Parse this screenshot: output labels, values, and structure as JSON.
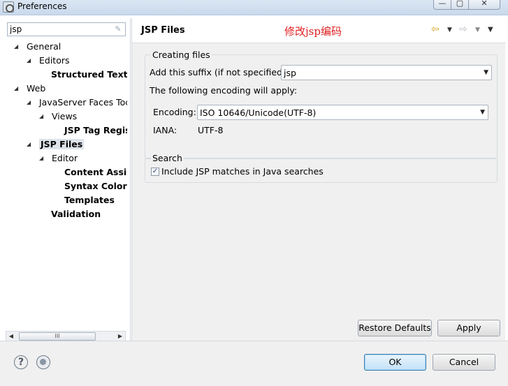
{
  "window": {
    "title": "Preferences",
    "min_glyph": "—",
    "max_glyph": "▢",
    "close_glyph": "✕"
  },
  "sidebar": {
    "filter": {
      "value": "jsp",
      "placeholder": ""
    },
    "tree": [
      {
        "label": "General",
        "expanded": true,
        "bold": false
      },
      {
        "label": "Editors",
        "expanded": true,
        "bold": false
      },
      {
        "label": "Structured Text E",
        "expanded": null,
        "bold": true
      },
      {
        "label": "Web",
        "expanded": true,
        "bold": false
      },
      {
        "label": "JavaServer Faces Toc",
        "expanded": true,
        "bold": false
      },
      {
        "label": "Views",
        "expanded": true,
        "bold": false
      },
      {
        "label": "JSP Tag Regis",
        "expanded": null,
        "bold": true
      },
      {
        "label": "JSP Files",
        "expanded": true,
        "bold": true,
        "selected": true
      },
      {
        "label": "Editor",
        "expanded": true,
        "bold": false
      },
      {
        "label": "Content Assis",
        "expanded": null,
        "bold": true
      },
      {
        "label": "Syntax Colori",
        "expanded": null,
        "bold": true
      },
      {
        "label": "Templates",
        "expanded": null,
        "bold": true
      },
      {
        "label": "Validation",
        "expanded": null,
        "bold": true
      }
    ]
  },
  "page": {
    "title": "JSP Files",
    "annotation": "修改jsp编码",
    "creating_files": {
      "legend": "Creating files",
      "suffix_label": "Add this suffix (if not specified):",
      "suffix_value": "jsp",
      "encoding_note": "The following encoding will apply:",
      "encoding_label": "Encoding:",
      "encoding_value": "ISO 10646/Unicode(UTF-8)",
      "iana_label": "IANA:",
      "iana_value": "UTF-8"
    },
    "search": {
      "legend": "Search",
      "checkbox_label": "Include JSP matches in Java searches",
      "checked": true
    },
    "restore_defaults_label": "Restore Defaults",
    "apply_label": "Apply"
  },
  "footer": {
    "ok_label": "OK",
    "cancel_label": "Cancel"
  }
}
